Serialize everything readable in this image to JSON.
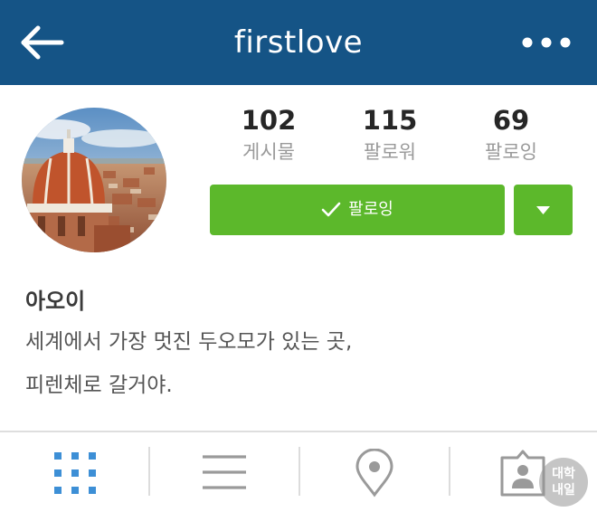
{
  "header": {
    "title": "firstlove",
    "back_icon": "arrow-left-icon",
    "more_icon": "more-dots-icon"
  },
  "profile": {
    "stats": [
      {
        "value": "102",
        "label": "게시물"
      },
      {
        "value": "115",
        "label": "팔로워"
      },
      {
        "value": "69",
        "label": "팔로잉"
      }
    ],
    "follow_button_label": "팔로잉",
    "follow_icon": "checkmark-icon",
    "dropdown_icon": "caret-down-icon"
  },
  "bio": {
    "name": "아오이",
    "lines": [
      "세계에서 가장 멋진 두오모가 있는 곳,",
      "피렌체로 갈거야."
    ]
  },
  "tabs": [
    {
      "icon": "grid-icon",
      "active": true
    },
    {
      "icon": "list-icon",
      "active": false
    },
    {
      "icon": "location-pin-icon",
      "active": false
    },
    {
      "icon": "tagged-person-icon",
      "active": false
    }
  ],
  "watermark": {
    "line1": "대학",
    "line2": "내일"
  },
  "colors": {
    "header_bg": "#155486",
    "follow_green": "#5cb82b",
    "active_tab_blue": "#3d8fd6",
    "inactive_icon_gray": "#9a9a9a"
  }
}
